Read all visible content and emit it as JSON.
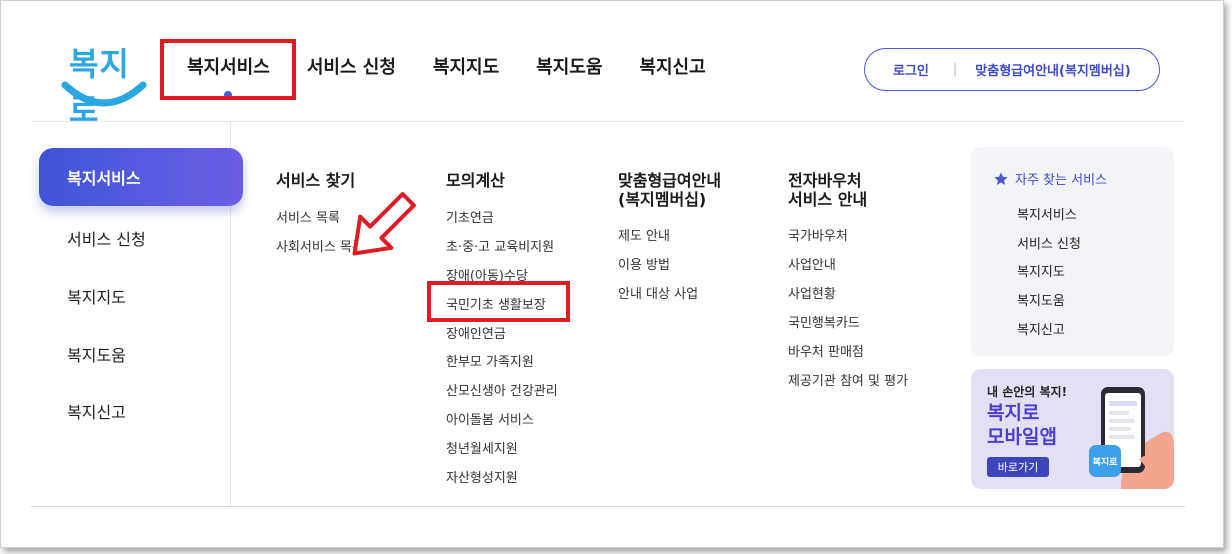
{
  "logo": {
    "text": "복지로"
  },
  "nav": {
    "items": [
      "복지서비스",
      "서비스 신청",
      "복지지도",
      "복지도움",
      "복지신고"
    ]
  },
  "top_buttons": {
    "login": "로그인",
    "membership": "맞춤형급여안내(복지멤버십)"
  },
  "sidebar": {
    "items": [
      "복지서비스",
      "서비스 신청",
      "복지지도",
      "복지도움",
      "복지신고"
    ]
  },
  "columns": [
    {
      "title": "서비스 찾기",
      "links": [
        "서비스 목록",
        "사회서비스 목록"
      ]
    },
    {
      "title": "모의계산",
      "links": [
        "기초연금",
        "초·중·고 교육비지원",
        "장애(아동)수당",
        "국민기초 생활보장",
        "장애인연금",
        "한부모 가족지원",
        "산모신생아 건강관리",
        "아이돌봄 서비스",
        "청년월세지원",
        "자산형성지원"
      ]
    },
    {
      "title_lines": [
        "맞춤형급여안내",
        "(복지멤버십)"
      ],
      "links": [
        "제도 안내",
        "이용 방법",
        "안내 대상 사업"
      ]
    },
    {
      "title_lines": [
        "전자바우처",
        "서비스 안내"
      ],
      "links": [
        "국가바우처",
        "사업안내",
        "사업현황",
        "국민행복카드",
        "바우처 판매점",
        "제공기관 참여 및 평가"
      ]
    }
  ],
  "favorites": {
    "title": "자주 찾는 서비스",
    "items": [
      "복지서비스",
      "서비스 신청",
      "복지지도",
      "복지도움",
      "복지신고"
    ]
  },
  "promo": {
    "line1": "내 손안의 복지!",
    "line2": "복지로",
    "line3": "모바일앱",
    "button": "바로가기",
    "app_badge": "복지로"
  },
  "colors": {
    "accent": "#4a58d8",
    "highlight": "#e01b24",
    "logo": "#2aa6e0"
  }
}
